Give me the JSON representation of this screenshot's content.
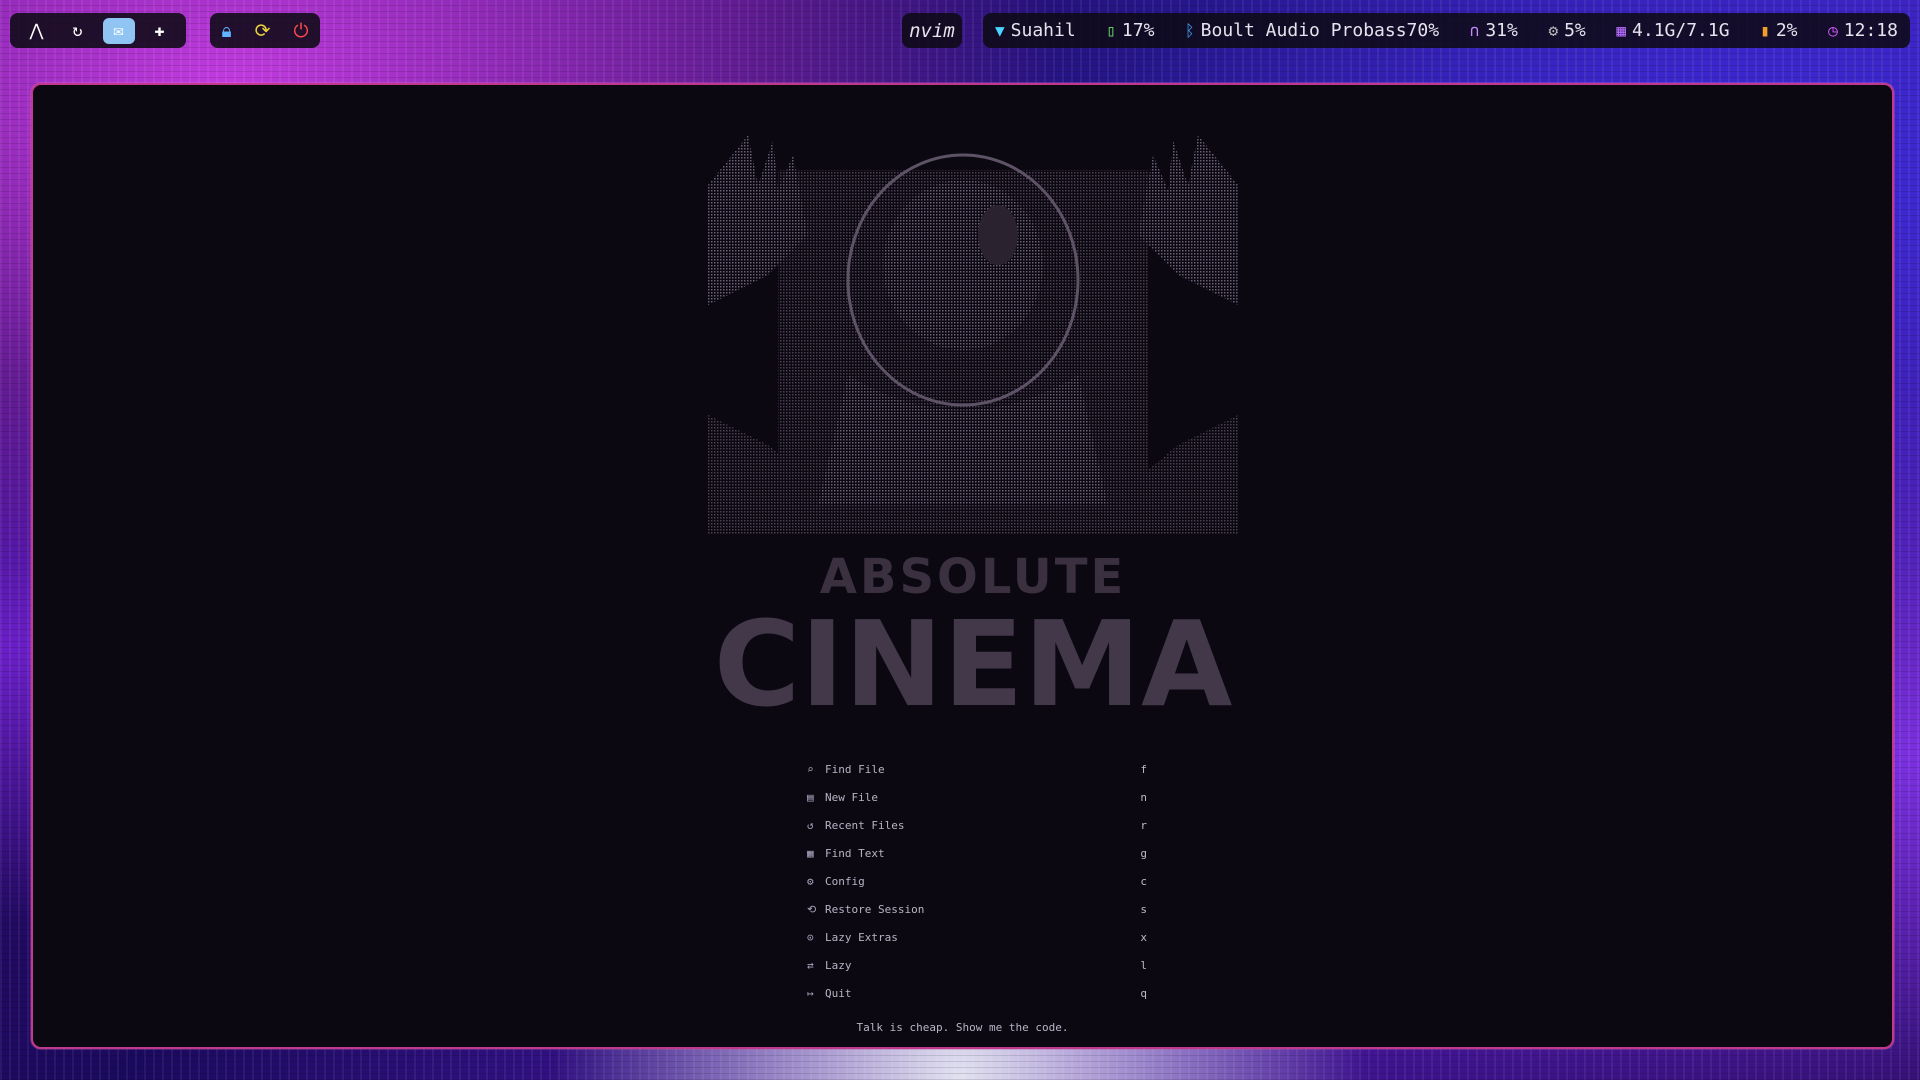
{
  "topbar": {
    "workspaces": [
      {
        "icon": "arch-logo-icon",
        "glyph": "⋀",
        "active": false
      },
      {
        "icon": "refresh-circle-icon",
        "glyph": "↻",
        "active": false
      },
      {
        "icon": "mail-icon",
        "glyph": "✉",
        "active": true
      },
      {
        "icon": "gamepad-icon",
        "glyph": "✚",
        "active": false
      }
    ],
    "system_buttons": [
      {
        "icon": "lock-icon",
        "glyph": "🔒",
        "color": "#5fb3ff"
      },
      {
        "icon": "reload-icon",
        "glyph": "⟳",
        "color": "#e8d23a"
      },
      {
        "icon": "power-icon",
        "glyph": "⏻",
        "color": "#ff4a4a"
      }
    ],
    "window_title": "nvim",
    "wifi": {
      "icon": "wifi-icon",
      "text": "Suahil",
      "color": "#4ad4ff"
    },
    "battery": {
      "icon": "battery-icon",
      "text": "17%",
      "color": "#6ee36e"
    },
    "bluetooth": {
      "icon": "bluetooth-icon",
      "text": "Boult Audio Probass70%",
      "color": "#4aa8ff"
    },
    "headphones": {
      "icon": "headphones-icon",
      "text": "31%",
      "color": "#c78bff"
    },
    "cpu": {
      "icon": "cpu-icon",
      "text": "5%",
      "color": "#bbbbbb"
    },
    "memory": {
      "icon": "memory-icon",
      "text": "4.1G/7.1G",
      "color": "#b56cff"
    },
    "disk": {
      "icon": "disk-icon",
      "text": "2%",
      "color": "#f0a028"
    },
    "clock": {
      "icon": "clock-icon",
      "text": "12:18",
      "color": "#d65bff"
    }
  },
  "dashboard": {
    "header_line1": "ABSOLUTE",
    "header_line2": "CINEMA",
    "items": [
      {
        "icon": "search-icon",
        "glyph": "⌕",
        "label": "Find File",
        "key": "f"
      },
      {
        "icon": "file-icon",
        "glyph": "▤",
        "label": "New File",
        "key": "n"
      },
      {
        "icon": "history-icon",
        "glyph": "↺",
        "label": "Recent Files",
        "key": "r"
      },
      {
        "icon": "text-search-icon",
        "glyph": "▦",
        "label": "Find Text",
        "key": "g"
      },
      {
        "icon": "gear-icon",
        "glyph": "⚙",
        "label": "Config",
        "key": "c"
      },
      {
        "icon": "session-icon",
        "glyph": "⟲",
        "label": "Restore Session",
        "key": "s"
      },
      {
        "icon": "extras-icon",
        "glyph": "⊙",
        "label": "Lazy Extras",
        "key": "x"
      },
      {
        "icon": "lazy-icon",
        "glyph": "⇄",
        "label": "Lazy",
        "key": "l"
      },
      {
        "icon": "quit-icon",
        "glyph": "↦",
        "label": "Quit",
        "key": "q"
      }
    ],
    "footer": "Talk is cheap. Show me the code."
  }
}
